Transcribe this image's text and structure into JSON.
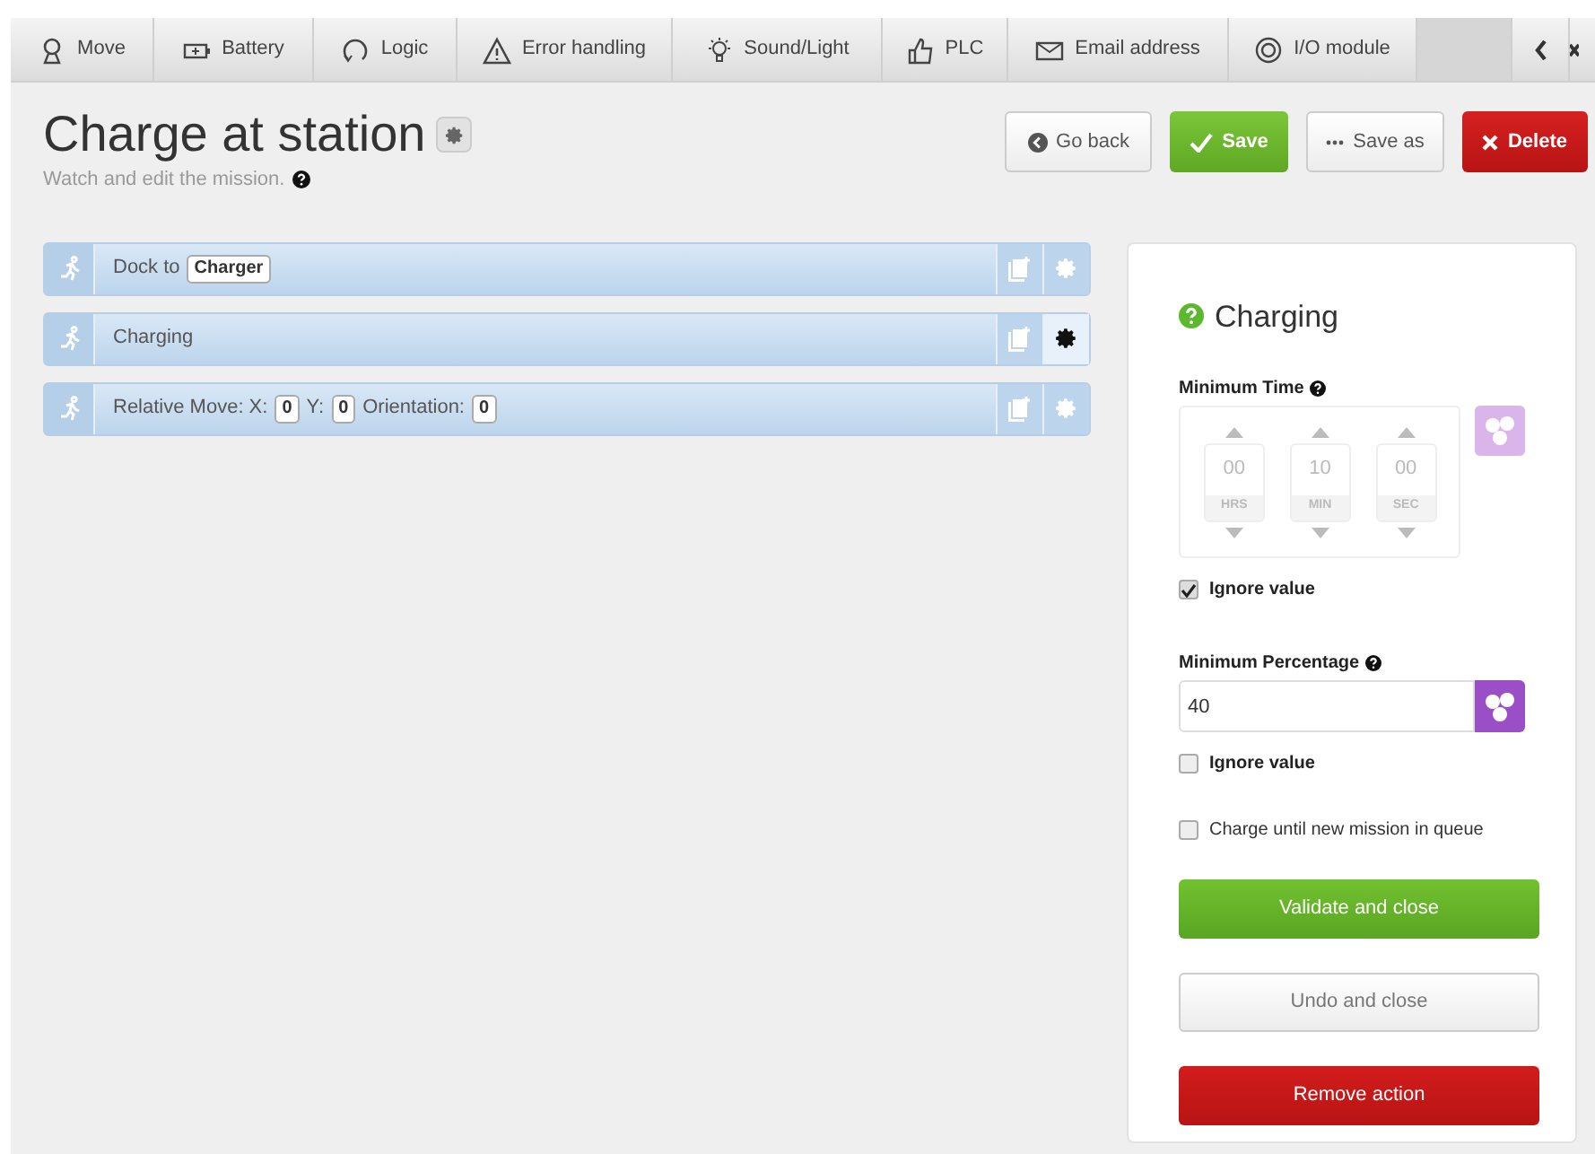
{
  "tabs": [
    {
      "kind": "pin",
      "label": "Move"
    },
    {
      "kind": "battery",
      "label": "Battery"
    },
    {
      "kind": "loop",
      "label": "Logic"
    },
    {
      "kind": "warning",
      "label": "Error handling"
    },
    {
      "kind": "bulb",
      "label": "Sound/Light"
    },
    {
      "kind": "thumb",
      "label": "PLC"
    },
    {
      "kind": "mail",
      "label": "Email address"
    },
    {
      "kind": "ring",
      "label": "I/O module"
    }
  ],
  "header": {
    "title": "Charge at station",
    "subtitle": "Watch and edit the mission."
  },
  "toolbar": [
    {
      "kind": "back",
      "label": "Go back"
    },
    {
      "kind": "save",
      "label": "Save"
    },
    {
      "kind": "saveas",
      "label": "Save as"
    },
    {
      "kind": "delete",
      "label": "Delete"
    }
  ],
  "actions": [
    {
      "selected": false,
      "parts": [
        {
          "kind": "text",
          "text": "Dock to"
        },
        {
          "kind": "chip",
          "text": "Charger"
        }
      ]
    },
    {
      "selected": true,
      "parts": [
        {
          "kind": "text",
          "text": "Charging"
        }
      ]
    },
    {
      "selected": false,
      "parts": [
        {
          "kind": "text",
          "text": "Relative Move: X:"
        },
        {
          "kind": "chip",
          "text": "0"
        },
        {
          "kind": "text",
          "text": "Y:"
        },
        {
          "kind": "chip",
          "text": "0"
        },
        {
          "kind": "text",
          "text": "Orientation:"
        },
        {
          "kind": "chip",
          "text": "0"
        }
      ]
    }
  ],
  "panel": {
    "title": "Charging",
    "time": {
      "label": "Minimum Time",
      "disabled": true,
      "fields": [
        {
          "value": "00",
          "unit": "HRS"
        },
        {
          "value": "10",
          "unit": "MIN"
        },
        {
          "value": "00",
          "unit": "SEC"
        }
      ],
      "ignore": {
        "label": "Ignore value",
        "checked": true
      }
    },
    "percentage": {
      "label": "Minimum Percentage",
      "value": "40",
      "ignore": {
        "label": "Ignore value",
        "checked": false
      }
    },
    "until_queue": {
      "label": "Charge until new mission in queue",
      "checked": false
    },
    "buttons": [
      {
        "kind": "validate",
        "label": "Validate and close"
      },
      {
        "kind": "undo",
        "label": "Undo and close"
      },
      {
        "kind": "remove",
        "label": "Remove action"
      }
    ]
  }
}
